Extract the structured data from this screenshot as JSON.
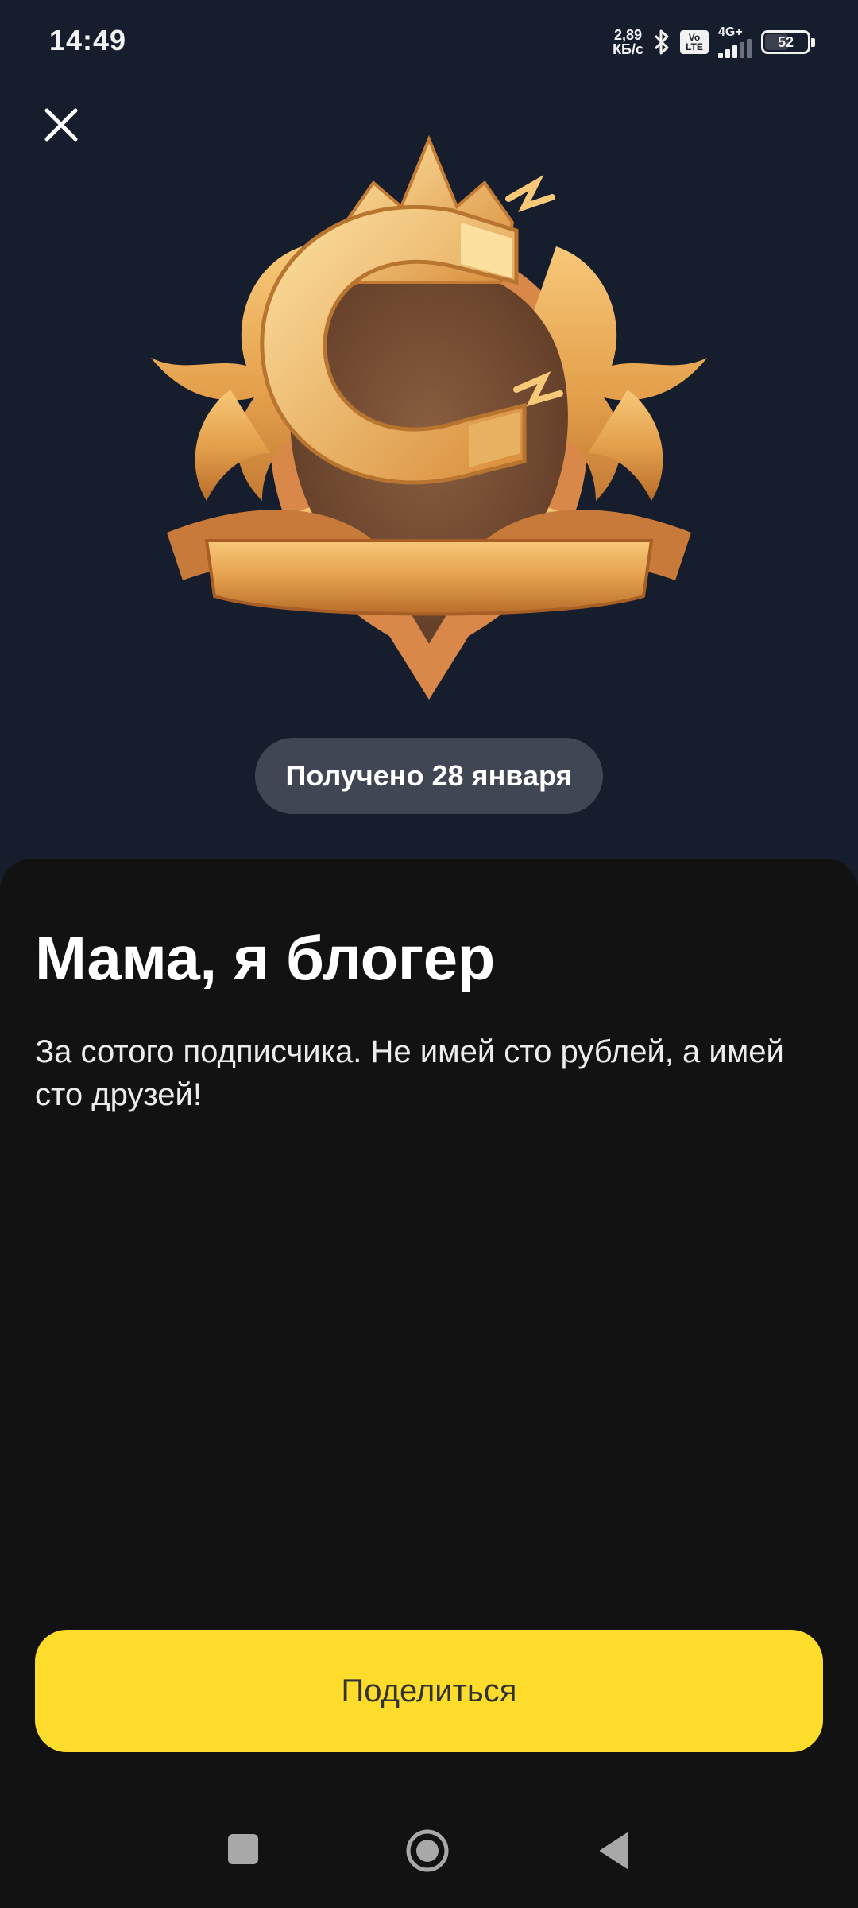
{
  "status_bar": {
    "time": "14:49",
    "net_speed_value": "2,89",
    "net_speed_unit": "КБ/с",
    "volte_top": "Vo",
    "volte_bottom": "LTE",
    "network": "4G+",
    "battery": "52",
    "icons": [
      "bluetooth-icon",
      "volte-icon",
      "signal-icon",
      "battery-icon"
    ]
  },
  "header": {
    "close_icon": "close-icon"
  },
  "achievement": {
    "badge_icon": "magnet-crest-badge",
    "received_label": "Получено 28 января",
    "title": "Мама, я блогер",
    "description": "За сотого подписчика. Не имей сто рублей, а имей сто друзей!"
  },
  "actions": {
    "share_label": "Поделиться"
  },
  "nav_bar": {
    "icons": [
      "recents-icon",
      "home-icon",
      "back-icon"
    ]
  },
  "colors": {
    "top_background": "#161d2c",
    "sheet_background": "#121212",
    "pill_background": "#404654",
    "accent_yellow": "#fddc2b",
    "gold": "#e8a54a"
  }
}
